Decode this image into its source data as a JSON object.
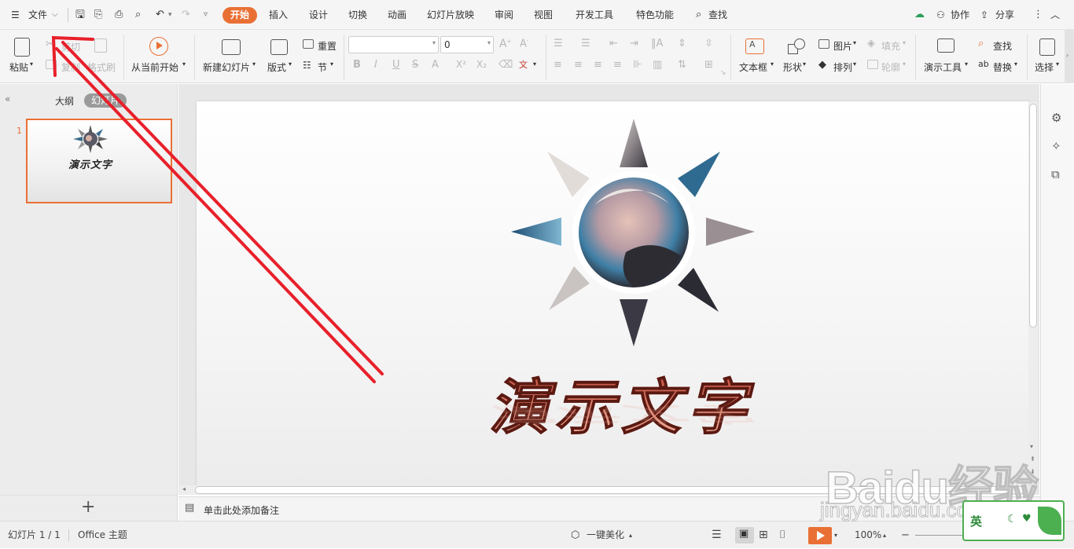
{
  "topbar": {
    "file_menu": "文件",
    "tabs": [
      "开始",
      "插入",
      "设计",
      "切换",
      "动画",
      "幻灯片放映",
      "审阅",
      "视图",
      "开发工具",
      "特色功能"
    ],
    "search": "查找",
    "collaborate": "协作",
    "share": "分享"
  },
  "ribbon": {
    "paste": "粘贴",
    "cut": "剪切",
    "copy": "复制",
    "format_painter": "格式刷",
    "from_current": "从当前开始",
    "new_slide": "新建幻灯片",
    "layout": "版式",
    "reset": "重置",
    "section": "节",
    "font_size": "0",
    "textbox": "文本框",
    "shape": "形状",
    "picture": "图片",
    "fill": "填充",
    "arrange": "排列",
    "outline": "轮廓",
    "present_tools": "演示工具",
    "find": "查找",
    "replace": "替换",
    "select": "选择"
  },
  "leftpanel": {
    "outline_tab": "大纲",
    "slides_tab": "幻灯片",
    "slide_number": "1",
    "thumb_title": "演示文字"
  },
  "slide": {
    "title": "演示文字"
  },
  "notes": {
    "placeholder": "单击此处添加备注"
  },
  "status": {
    "slide_count": "幻灯片 1 / 1",
    "theme": "Office 主题",
    "beautify": "一键美化",
    "zoom": "100%"
  },
  "watermark": {
    "brand": "Baidu经验",
    "url": "jingyan.baidu.com",
    "badge": "英 "
  },
  "colors": {
    "accent": "#e97034",
    "annotation_arrow": "#e8202a",
    "title_gradient_top": "#c0392b",
    "title_gradient_bottom": "#f6b8a3"
  }
}
